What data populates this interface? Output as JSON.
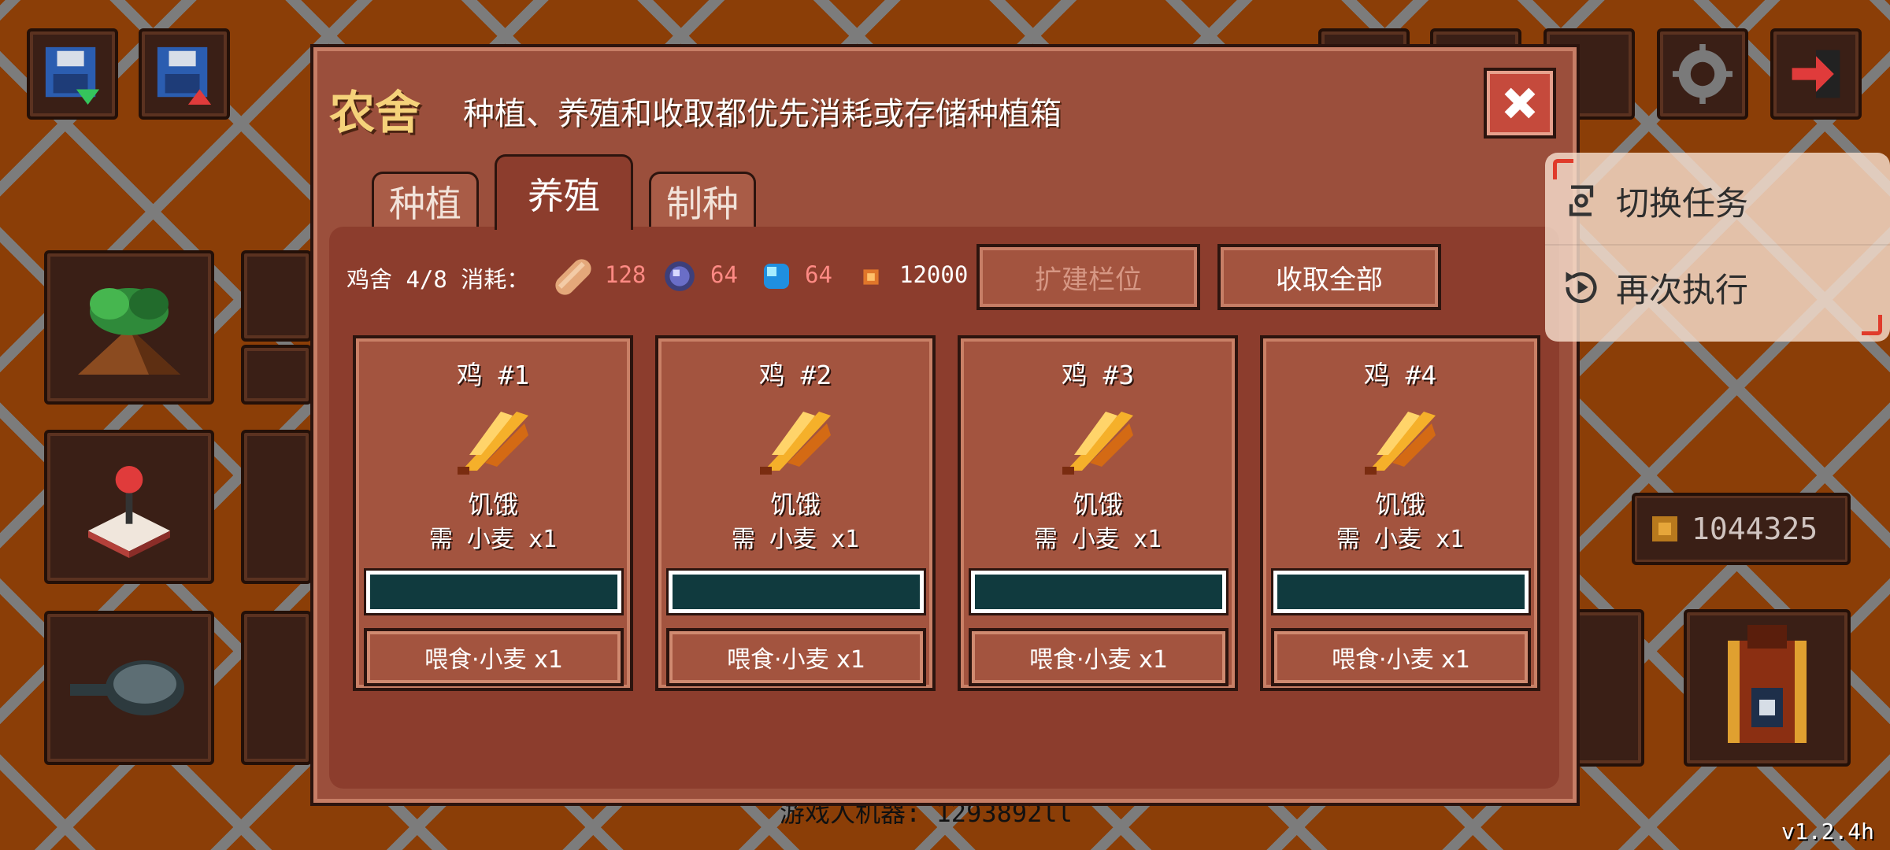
{
  "dialog": {
    "title": "农舍",
    "subtitle": "种植、养殖和收取都优先消耗或存储种植箱",
    "close_icon": "close-x-icon"
  },
  "tabs": [
    {
      "label": "种植",
      "active": false
    },
    {
      "label": "养殖",
      "active": true
    },
    {
      "label": "制种",
      "active": false
    }
  ],
  "stats": {
    "coop_label": "鸡舍 4/8 消耗：",
    "items": [
      {
        "icon": "bread-icon",
        "value": "128"
      },
      {
        "icon": "purple-orb-icon",
        "value": "64"
      },
      {
        "icon": "blue-gem-icon",
        "value": "64"
      },
      {
        "icon": "coin-icon",
        "value": "12000"
      }
    ]
  },
  "actions": {
    "expand_label": "扩建栏位",
    "collect_all_label": "收取全部"
  },
  "chickens": [
    {
      "name": "鸡 #1",
      "state": "饥饿",
      "need": "需 小麦 x1",
      "progress": 0,
      "feed_label": "喂食·小麦 x1"
    },
    {
      "name": "鸡 #2",
      "state": "饥饿",
      "need": "需 小麦 x1",
      "progress": 0,
      "feed_label": "喂食·小麦 x1"
    },
    {
      "name": "鸡 #3",
      "state": "饥饿",
      "need": "需 小麦 x1",
      "progress": 0,
      "feed_label": "喂食·小麦 x1"
    },
    {
      "name": "鸡 #4",
      "state": "饥饿",
      "need": "需 小麦 x1",
      "progress": 0,
      "feed_label": "喂食·小麦 x1"
    }
  ],
  "overlay": {
    "switch_task": "切换任务",
    "rerun": "再次执行"
  },
  "hud": {
    "coins": "1044325",
    "footer_text": "游戏人机器: 1293892ll",
    "version": "v1.2.4h"
  },
  "colors": {
    "background": "#8b3e07",
    "dialog": "#9b4f3c",
    "title": "#f5d27a",
    "progress_track": "#103a3e",
    "consumption_value": "#ff8a84"
  }
}
